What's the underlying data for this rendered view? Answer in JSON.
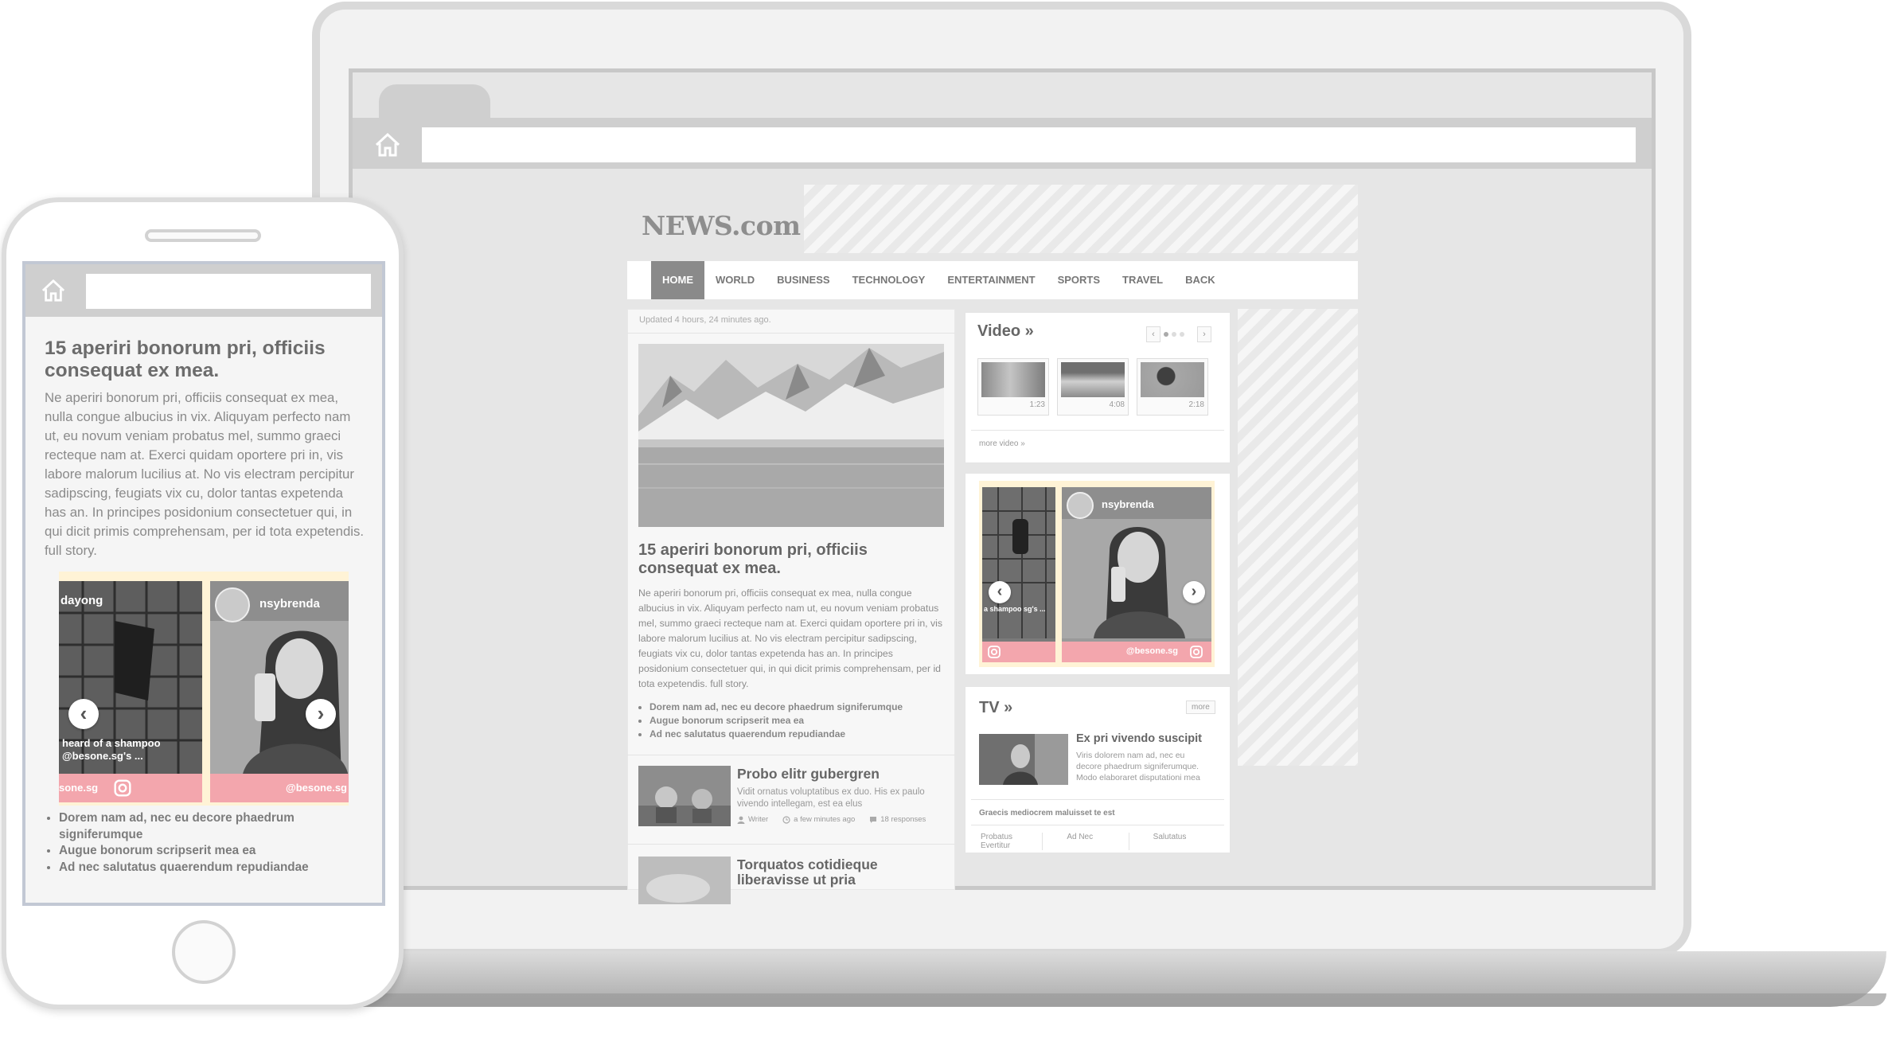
{
  "site": {
    "logo": "NEWS.com"
  },
  "nav": {
    "items": [
      "HOME",
      "WORLD",
      "BUSINESS",
      "TECHNOLOGY",
      "ENTERTAINMENT",
      "SPORTS",
      "TRAVEL",
      "BACK"
    ],
    "active": "HOME"
  },
  "main": {
    "updated": "Updated 4 hours, 24 minutes ago.",
    "title": "15 aperiri bonorum pri, officiis consequat ex mea.",
    "body": "Ne aperiri bonorum pri, officiis consequat ex mea, nulla congue albucius in vix. Aliquyam perfecto nam ut, eu novum veniam probatus mel, summo graeci recteque nam at. Exerci quidam oportere pri in, vis labore malorum lucilius at. No vis electram percipitur sadipscing, feugiats vix cu, dolor tantas expetenda has an. In principes posidonium consectetuer qui, in qui dicit primis comprehensam, per id tota expetendis. full story.",
    "bullets": [
      "Dorem nam ad, nec eu decore phaedrum signiferumque",
      "Augue bonorum scripserit mea ea",
      "Ad nec salutatus quaerendum repudiandae"
    ]
  },
  "stories": [
    {
      "title": "Probo elitr gubergren",
      "desc": "Vidit ornatus voluptatibus ex duo. His ex paulo vivendo intellegam, est ea elus",
      "author": "Writer",
      "time": "a few minutes ago",
      "responses": "18 responses"
    },
    {
      "title": "Torquatos cotidieque liberavisse ut pria"
    }
  ],
  "video": {
    "title": "Video »",
    "prev": "‹",
    "next": "›",
    "items": [
      {
        "duration": "1:23"
      },
      {
        "duration": "4:08"
      },
      {
        "duration": "2:18"
      }
    ],
    "more": "more video »"
  },
  "instagram": {
    "user1": "dayong",
    "user2": "nsybrenda",
    "caption1": "heard of a shampoo @besone.sg's ...",
    "caption1_short": "a shampoo sg's ...",
    "handle": "@besone.sg",
    "handle_short": "sone.sg",
    "prev": "‹",
    "next": "›"
  },
  "tv": {
    "title": "TV »",
    "more": "more",
    "headline": "Ex pri vivendo suscipit",
    "desc": "Viris dolorem nam ad, nec eu decore phaedrum signiferumque. Modo elaboraret disputationi mea",
    "sub": "Graecis mediocrem maluisset te est",
    "links": [
      "Probatus Evertitur",
      "Ad Nec",
      "Salutatus"
    ]
  },
  "phone": {
    "title": "15 aperiri bonorum pri, officiis consequat ex mea.",
    "body": "Ne aperiri bonorum pri, officiis consequat ex mea, nulla congue albucius in vix. Aliquyam perfecto nam ut, eu novum veniam probatus mel, summo graeci recteque nam at. Exerci quidam oportere pri in, vis labore malorum lucilius at. No vis electram percipitur sadipscing, feugiats vix cu, dolor tantas expetenda has an. In principes posidonium consectetuer qui, in qui dicit primis comprehensam, per id tota expetendis. full story.",
    "bullets": [
      "Dorem nam ad, nec eu decore phaedrum signiferumque",
      "Augue bonorum scripserit mea ea",
      "Ad nec salutatus quaerendum repudiandae"
    ]
  },
  "icons": {
    "home": "home-icon",
    "instagram": "instagram-icon",
    "user": "user-icon",
    "clock": "clock-icon",
    "comment": "comment-icon"
  },
  "colors": {
    "nav_active": "#8a8a8a",
    "instagram_footer": "#f3a6ad",
    "instagram_bg": "#fff3d6"
  }
}
